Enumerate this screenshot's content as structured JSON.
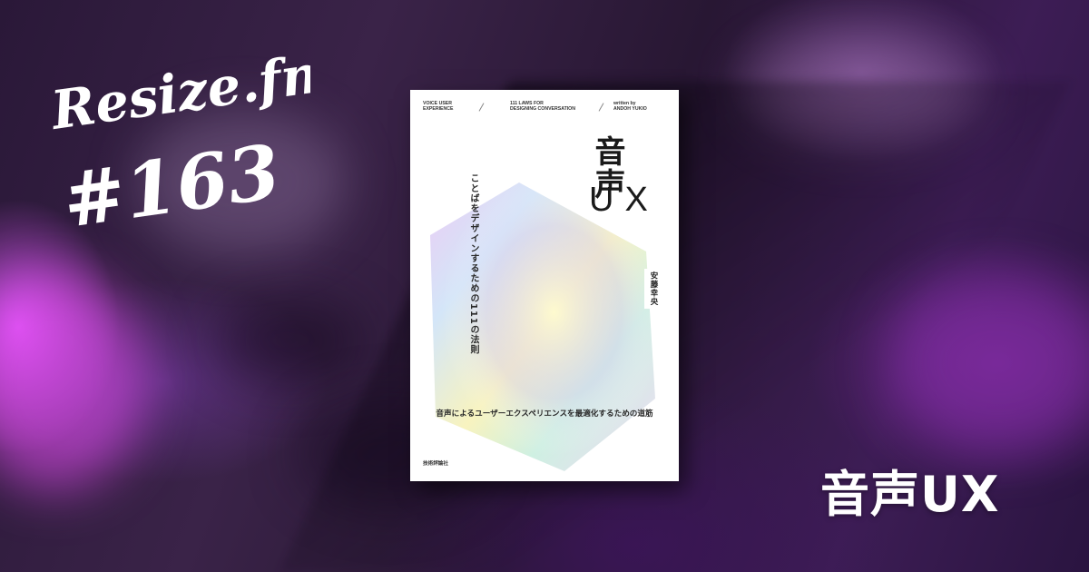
{
  "brand": {
    "name": "Resize.fm",
    "episode": "#163"
  },
  "episode_title": "音声UX",
  "book": {
    "top_left": [
      "VOICE USER",
      "EXPERIENCE"
    ],
    "top_center": [
      "111 LAWS FOR",
      "DESIGNING CONVERSATION"
    ],
    "top_right": [
      "written by",
      "ANDOH YUKIO"
    ],
    "title_jp": "音声",
    "title_en": "UX",
    "subtitle": "ことばをデザインするための111の法則",
    "author": "安藤幸央",
    "tagline": "音声によるユーザーエクスペリエンスを最適化するための道筋",
    "publisher": "技術評論社"
  },
  "colors": {
    "background": "#2a1838",
    "accent_magenta": "#e45aff",
    "book_bg": "#ffffff",
    "text_white": "#ffffff"
  }
}
